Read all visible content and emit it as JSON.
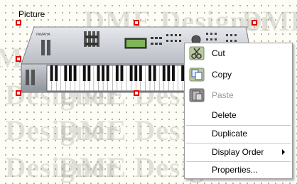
{
  "canvas": {
    "watermark": "DME Designer",
    "picture_label": "Picture"
  },
  "picture": {
    "brand": "YAMAHA",
    "icon": "synthesizer-keyboard-image"
  },
  "context_menu": {
    "items": [
      {
        "label": "Cut",
        "icon": "scissors-icon",
        "enabled": true
      },
      {
        "label": "Copy",
        "icon": "copy-icon",
        "enabled": true
      },
      {
        "label": "Paste",
        "icon": "paste-icon",
        "enabled": false
      },
      {
        "label": "Delete",
        "enabled": true
      },
      {
        "label": "Duplicate",
        "enabled": true
      },
      {
        "label": "Display Order",
        "submenu": true,
        "enabled": true
      },
      {
        "label": "Properties...",
        "enabled": true
      }
    ]
  },
  "colors": {
    "selection_handle": "#e00000",
    "menu_border": "#9a9a9a",
    "disabled_text": "#9a9a9a"
  }
}
